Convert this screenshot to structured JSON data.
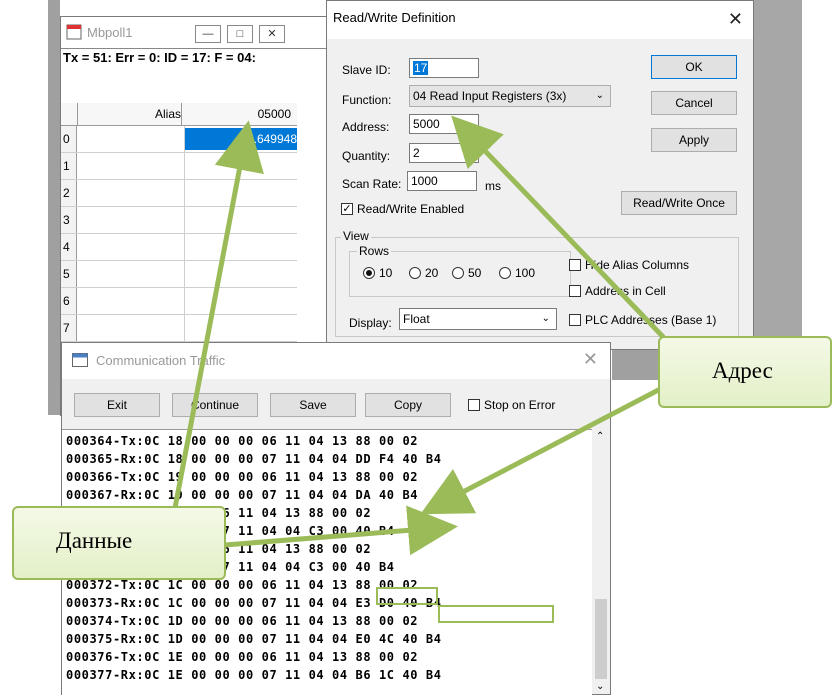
{
  "mbpoll": {
    "title": "Mbpoll1",
    "status": "Tx = 51: Err = 0: ID = 17: F = 04:",
    "header_alias": "Alias",
    "header_address": "05000",
    "rows": [
      "0",
      "1",
      "2",
      "3",
      "4",
      "5",
      "6",
      "7"
    ],
    "value_row0": "5.649948"
  },
  "rw": {
    "title": "Read/Write Definition",
    "slave_id_label": "Slave ID:",
    "slave_id": "17",
    "function_label": "Function:",
    "function": "04 Read Input Registers (3x)",
    "address_label": "Address:",
    "address": "5000",
    "quantity_label": "Quantity:",
    "quantity": "2",
    "scan_rate_label": "Scan Rate:",
    "scan_rate": "1000",
    "ms": "ms",
    "rw_enabled": "Read/Write Enabled",
    "ok": "OK",
    "cancel": "Cancel",
    "apply": "Apply",
    "rw_once": "Read/Write Once",
    "view": "View",
    "rows_label": "Rows",
    "rows_options": [
      "10",
      "20",
      "50",
      "100"
    ],
    "hide_alias": "Hide Alias Columns",
    "address_in_cell": "Address in Cell",
    "plc_addresses": "PLC Addresses (Base 1)",
    "display_label": "Display:",
    "display": "Float"
  },
  "ct": {
    "title": "Communication Traffic",
    "exit": "Exit",
    "continue": "Continue",
    "save": "Save",
    "copy": "Copy",
    "stop_on_error": "Stop on Error",
    "lines": [
      "000364-Tx:0C 18 00 00 00 06 11 04 13 88 00 02",
      "000365-Rx:0C 18 00 00 00 07 11 04 04 DD F4 40 B4",
      "000366-Tx:0C 19 00 00 00 06 11 04 13 88 00 02",
      "000367-Rx:0C 19 00 00 00 07 11 04 04 DA 40 B4",
      "          00 00 00 06 11 04 13 88 00 02",
      "          00 00 00 07 11 04 04 C3 00 40 B4",
      "          00 00 00 06 11 04 13 88 00 02",
      "          00 00 00 07 11 04 04 C3 00 40 B4",
      "000372-Tx:0C 1C 00 00 00 06 11 04 13 88 00 02",
      "000373-Rx:0C 1C 00 00 00 07 11 04 04 E3 D0 40 B4",
      "000374-Tx:0C 1D 00 00 00 06 11 04 13 88 00 02",
      "000375-Rx:0C 1D 00 00 00 07 11 04 04 E0 4C 40 B4",
      "000376-Tx:0C 1E 00 00 00 06 11 04 13 88 00 02",
      "000377-Rx:0C 1E 00 00 00 07 11 04 04 B6 1C 40 B4"
    ]
  },
  "callouts": {
    "address": "Адрес",
    "data": "Данные"
  },
  "colors": {
    "selection": "#0078d7",
    "callout_border": "#9bbb59",
    "arrow": "#9bbb59"
  }
}
